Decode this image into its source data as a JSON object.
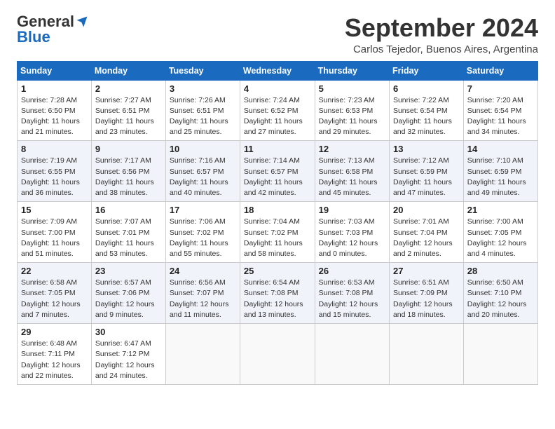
{
  "header": {
    "logo_general": "General",
    "logo_blue": "Blue",
    "month": "September 2024",
    "location": "Carlos Tejedor, Buenos Aires, Argentina"
  },
  "weekdays": [
    "Sunday",
    "Monday",
    "Tuesday",
    "Wednesday",
    "Thursday",
    "Friday",
    "Saturday"
  ],
  "weeks": [
    [
      {
        "day": 1,
        "info": "Sunrise: 7:28 AM\nSunset: 6:50 PM\nDaylight: 11 hours\nand 21 minutes."
      },
      {
        "day": 2,
        "info": "Sunrise: 7:27 AM\nSunset: 6:51 PM\nDaylight: 11 hours\nand 23 minutes."
      },
      {
        "day": 3,
        "info": "Sunrise: 7:26 AM\nSunset: 6:51 PM\nDaylight: 11 hours\nand 25 minutes."
      },
      {
        "day": 4,
        "info": "Sunrise: 7:24 AM\nSunset: 6:52 PM\nDaylight: 11 hours\nand 27 minutes."
      },
      {
        "day": 5,
        "info": "Sunrise: 7:23 AM\nSunset: 6:53 PM\nDaylight: 11 hours\nand 29 minutes."
      },
      {
        "day": 6,
        "info": "Sunrise: 7:22 AM\nSunset: 6:54 PM\nDaylight: 11 hours\nand 32 minutes."
      },
      {
        "day": 7,
        "info": "Sunrise: 7:20 AM\nSunset: 6:54 PM\nDaylight: 11 hours\nand 34 minutes."
      }
    ],
    [
      {
        "day": 8,
        "info": "Sunrise: 7:19 AM\nSunset: 6:55 PM\nDaylight: 11 hours\nand 36 minutes."
      },
      {
        "day": 9,
        "info": "Sunrise: 7:17 AM\nSunset: 6:56 PM\nDaylight: 11 hours\nand 38 minutes."
      },
      {
        "day": 10,
        "info": "Sunrise: 7:16 AM\nSunset: 6:57 PM\nDaylight: 11 hours\nand 40 minutes."
      },
      {
        "day": 11,
        "info": "Sunrise: 7:14 AM\nSunset: 6:57 PM\nDaylight: 11 hours\nand 42 minutes."
      },
      {
        "day": 12,
        "info": "Sunrise: 7:13 AM\nSunset: 6:58 PM\nDaylight: 11 hours\nand 45 minutes."
      },
      {
        "day": 13,
        "info": "Sunrise: 7:12 AM\nSunset: 6:59 PM\nDaylight: 11 hours\nand 47 minutes."
      },
      {
        "day": 14,
        "info": "Sunrise: 7:10 AM\nSunset: 6:59 PM\nDaylight: 11 hours\nand 49 minutes."
      }
    ],
    [
      {
        "day": 15,
        "info": "Sunrise: 7:09 AM\nSunset: 7:00 PM\nDaylight: 11 hours\nand 51 minutes."
      },
      {
        "day": 16,
        "info": "Sunrise: 7:07 AM\nSunset: 7:01 PM\nDaylight: 11 hours\nand 53 minutes."
      },
      {
        "day": 17,
        "info": "Sunrise: 7:06 AM\nSunset: 7:02 PM\nDaylight: 11 hours\nand 55 minutes."
      },
      {
        "day": 18,
        "info": "Sunrise: 7:04 AM\nSunset: 7:02 PM\nDaylight: 11 hours\nand 58 minutes."
      },
      {
        "day": 19,
        "info": "Sunrise: 7:03 AM\nSunset: 7:03 PM\nDaylight: 12 hours\nand 0 minutes."
      },
      {
        "day": 20,
        "info": "Sunrise: 7:01 AM\nSunset: 7:04 PM\nDaylight: 12 hours\nand 2 minutes."
      },
      {
        "day": 21,
        "info": "Sunrise: 7:00 AM\nSunset: 7:05 PM\nDaylight: 12 hours\nand 4 minutes."
      }
    ],
    [
      {
        "day": 22,
        "info": "Sunrise: 6:58 AM\nSunset: 7:05 PM\nDaylight: 12 hours\nand 7 minutes."
      },
      {
        "day": 23,
        "info": "Sunrise: 6:57 AM\nSunset: 7:06 PM\nDaylight: 12 hours\nand 9 minutes."
      },
      {
        "day": 24,
        "info": "Sunrise: 6:56 AM\nSunset: 7:07 PM\nDaylight: 12 hours\nand 11 minutes."
      },
      {
        "day": 25,
        "info": "Sunrise: 6:54 AM\nSunset: 7:08 PM\nDaylight: 12 hours\nand 13 minutes."
      },
      {
        "day": 26,
        "info": "Sunrise: 6:53 AM\nSunset: 7:08 PM\nDaylight: 12 hours\nand 15 minutes."
      },
      {
        "day": 27,
        "info": "Sunrise: 6:51 AM\nSunset: 7:09 PM\nDaylight: 12 hours\nand 18 minutes."
      },
      {
        "day": 28,
        "info": "Sunrise: 6:50 AM\nSunset: 7:10 PM\nDaylight: 12 hours\nand 20 minutes."
      }
    ],
    [
      {
        "day": 29,
        "info": "Sunrise: 6:48 AM\nSunset: 7:11 PM\nDaylight: 12 hours\nand 22 minutes."
      },
      {
        "day": 30,
        "info": "Sunrise: 6:47 AM\nSunset: 7:12 PM\nDaylight: 12 hours\nand 24 minutes."
      },
      null,
      null,
      null,
      null,
      null
    ]
  ]
}
